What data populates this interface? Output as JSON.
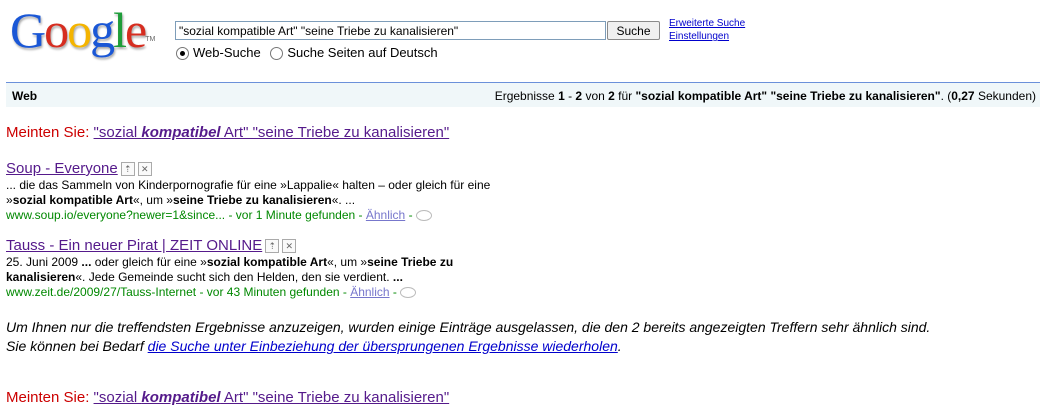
{
  "logo": {
    "text": "Google",
    "tm": "TM"
  },
  "search": {
    "query": "\"sozial kompatible Art\" \"seine Triebe zu kanalisieren\"",
    "button": "Suche"
  },
  "top_links": {
    "advanced": "Erweiterte Suche",
    "settings": "Einstellungen"
  },
  "radios": {
    "web": "Web-Suche",
    "german": "Suche Seiten auf Deutsch"
  },
  "web_bar": {
    "label": "Web",
    "stats_prefix": "Ergebnisse ",
    "range_from": "1",
    "range_sep": " - ",
    "range_to": "2",
    "of": " von ",
    "total": "2",
    "for": " für ",
    "query": "\"sozial kompatible Art\" \"seine Triebe zu kanalisieren\"",
    "dot": ". (",
    "time": "0,27",
    "seconds": " Sekunden)"
  },
  "did_you_mean": {
    "label": "Meinten Sie: ",
    "pre": "\"sozial ",
    "bold": "kompatibel",
    "post": " Art\" \"seine Triebe zu kanalisieren\""
  },
  "results": [
    {
      "title": "Soup - Everyone",
      "line1": "... die das Sammeln von Kinderpornografie für eine »Lappalie« halten – oder gleich für eine",
      "line2_parts": [
        "»",
        "sozial kompatible Art",
        "«, um »",
        "seine Triebe zu kanalisieren",
        "«. ..."
      ],
      "url": "www.soup.io/everyone?newer=1&since...",
      "meta": " - vor 1 Minute gefunden - ",
      "similar": "Ähnlich",
      "trail": " -"
    },
    {
      "title": "Tauss - Ein neuer Pirat | ZEIT ONLINE",
      "line1_parts": [
        "25. Juni 2009 ",
        "...",
        " oder gleich für eine »",
        "sozial kompatible Art",
        "«, um »",
        "seine Triebe zu"
      ],
      "line2_parts": [
        "kanalisieren",
        "«. Jede Gemeinde sucht sich den Helden, den sie verdient. ",
        "..."
      ],
      "url": "www.zeit.de/2009/27/Tauss-Internet",
      "meta": " - vor 43 Minuten gefunden - ",
      "similar": "Ähnlich",
      "trail": " -"
    }
  ],
  "omitted": {
    "line1": "Um Ihnen nur die treffendsten Ergebnisse anzuzeigen, wurden einige Einträge ausgelassen, die den 2 bereits angezeigten Treffern sehr ähnlich sind.",
    "line2_pre": "Sie können bei Bedarf ",
    "link": "die Suche unter Einbeziehung der übersprungenen Ergebnisse wiederholen",
    "line2_post": "."
  },
  "colors": {
    "logo": [
      "#1a57d6",
      "#d62d20",
      "#f4b400",
      "#1a57d6",
      "#1f9d3a",
      "#d62d20"
    ]
  }
}
